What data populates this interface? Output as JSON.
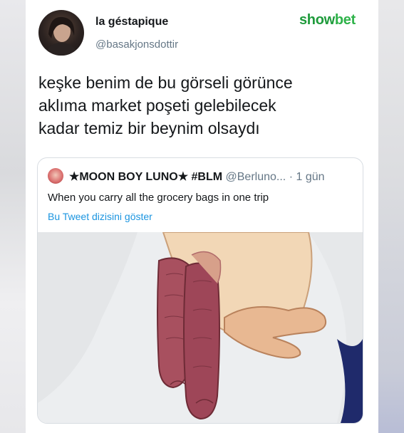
{
  "author": {
    "display_name": "la géstapique",
    "handle": "@basakjonsdottir"
  },
  "watermark": {
    "part1": "show",
    "part2": "bet"
  },
  "tweet": {
    "lines": [
      "keşke benim de bu görseli görünce",
      "aklıma market poşeti gelebilecek",
      "kadar temiz bir beynim olsaydı"
    ]
  },
  "quoted_tweet": {
    "name": "★MOON BOY LUNO★ #BLM",
    "handle": "@Berluno...",
    "dot": "·",
    "time": "1 gün",
    "text": "When you carry all the grocery bags in one trip",
    "thread_link": "Bu Tweet dizisini göster"
  },
  "colors": {
    "text": "#14171a",
    "secondary": "#657786",
    "link": "#1b95e0",
    "brand_dark": "#1f9b3c",
    "brand_light": "#2fb34a"
  }
}
